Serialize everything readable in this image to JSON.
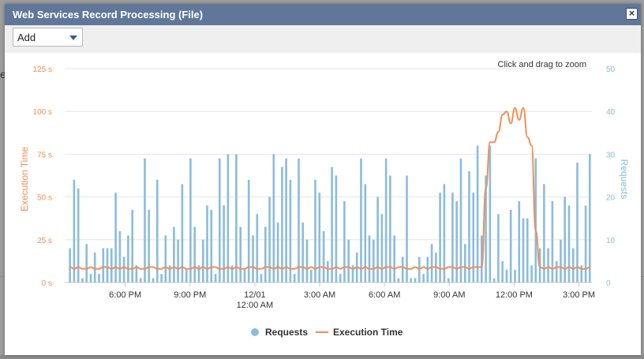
{
  "dialog": {
    "title": "Web Services Record Processing (File)",
    "close_glyph": "×",
    "close_icon": "close-icon"
  },
  "toolbar": {
    "select_value": "Add",
    "select_icon": "chevron-down-icon"
  },
  "background": {
    "letter": "e"
  },
  "colors": {
    "titlebar": "#607799",
    "requests": "#8bbcdb",
    "execution": "#f28e55",
    "left_axis_text": "#f28e55",
    "right_axis_text": "#8bbcdb"
  },
  "chart_data": {
    "type": "bar",
    "zoom_hint": "Click and drag to zoom",
    "ylabel_left": "Execution Time",
    "ylabel_right": "Requests",
    "yleft_ticks": [
      "0 s",
      "25 s",
      "50 s",
      "75 s",
      "100 s",
      "125 s"
    ],
    "yleft_range": [
      0,
      125
    ],
    "yright_ticks": [
      "0",
      "10",
      "20",
      "30",
      "40",
      "50"
    ],
    "yright_range": [
      0,
      50
    ],
    "grid": true,
    "legend_position": "bottom-center",
    "x_ticks": [
      {
        "label": "6:00 PM",
        "label2": "",
        "hour": 3
      },
      {
        "label": "9:00 PM",
        "label2": "",
        "hour": 6
      },
      {
        "label": "12/01",
        "label2": "12:00 AM",
        "hour": 9
      },
      {
        "label": "3:00 AM",
        "label2": "",
        "hour": 12
      },
      {
        "label": "6:00 AM",
        "label2": "",
        "hour": 15
      },
      {
        "label": "9:00 AM",
        "label2": "",
        "hour": 18
      },
      {
        "label": "12:00 PM",
        "label2": "",
        "hour": 21
      },
      {
        "label": "3:00 PM",
        "label2": "",
        "hour": 24
      }
    ],
    "x_range_hours": [
      0.2,
      24.6
    ],
    "series": [
      {
        "name": "Requests",
        "kind": "bar",
        "values": [
          8,
          24,
          22,
          1,
          9,
          2,
          7,
          2,
          8,
          8,
          8,
          21,
          12,
          6,
          11,
          17,
          4,
          1,
          29,
          17,
          1,
          24,
          2,
          11,
          4,
          13,
          10,
          23,
          3,
          29,
          13,
          4,
          10,
          18,
          17,
          2,
          29,
          18,
          30,
          4,
          30,
          13,
          3,
          24,
          11,
          16,
          2,
          13,
          20,
          30,
          14,
          27,
          29,
          24,
          2,
          29,
          14,
          10,
          3,
          24,
          21,
          12,
          5,
          27,
          25,
          2,
          19,
          10,
          4,
          7,
          29,
          23,
          11,
          10,
          20,
          16,
          29,
          25,
          11,
          1,
          6,
          25,
          1,
          1,
          6,
          2,
          6,
          9,
          7,
          21,
          23,
          1,
          21,
          19,
          29,
          9,
          26,
          21,
          32,
          11,
          25,
          32,
          1,
          16,
          5,
          3,
          17,
          3,
          19,
          15,
          15,
          4,
          29,
          8,
          23,
          8,
          19,
          5,
          10,
          20,
          18,
          8,
          28,
          4,
          18,
          30
        ],
        "color": "#8bbcdb"
      },
      {
        "name": "Execution Time",
        "kind": "line",
        "values": [
          9,
          8,
          9,
          8,
          8,
          9,
          8,
          8,
          9,
          9,
          8,
          9,
          8,
          9,
          8,
          8,
          9,
          8,
          8,
          9,
          9,
          8,
          8,
          9,
          8,
          9,
          8,
          9,
          8,
          8,
          9,
          8,
          9,
          8,
          9,
          9,
          8,
          8,
          9,
          8,
          9,
          8,
          8,
          9,
          9,
          8,
          8,
          9,
          9,
          8,
          9,
          8,
          9,
          8,
          8,
          9,
          9,
          8,
          9,
          8,
          9,
          9,
          8,
          8,
          9,
          8,
          9,
          9,
          8,
          9,
          8,
          9,
          8,
          8,
          9,
          8,
          9,
          9,
          8,
          9,
          9,
          8,
          8,
          9,
          8,
          9,
          8,
          9,
          9,
          8,
          8,
          9,
          9,
          8,
          9,
          9,
          8,
          9,
          9,
          9,
          55,
          82,
          82,
          88,
          98,
          100,
          93,
          102,
          95,
          102,
          85,
          80,
          30,
          9,
          8,
          9,
          8,
          9,
          9,
          8,
          9,
          8,
          9,
          8,
          8,
          9
        ],
        "color": "#f28e55"
      }
    ]
  }
}
